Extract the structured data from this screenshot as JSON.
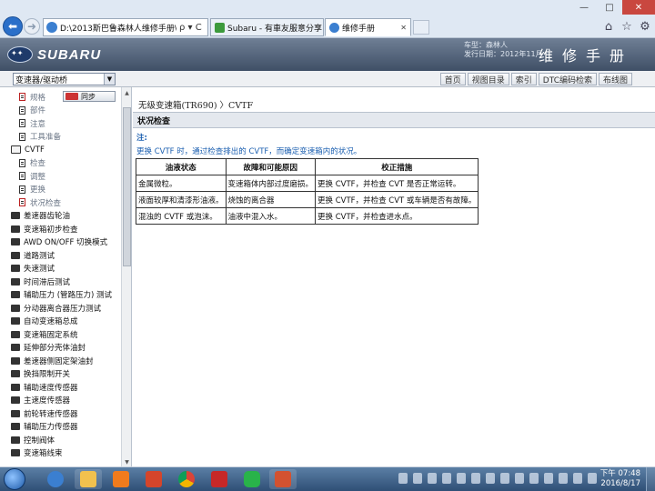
{
  "browser": {
    "address": "D:\\2013斯巴鲁森林人维修手册\\index.h",
    "address_controls": "ρ ▾ C",
    "tabs": [
      {
        "label": "Subaru - 有車友服意分享!頁...",
        "close": "✕"
      },
      {
        "label": "维修手册",
        "close": "✕"
      }
    ],
    "window_controls": [
      "—",
      "□",
      "✕"
    ]
  },
  "header": {
    "brand": "SUBARU",
    "model_line": "车型：森林人",
    "date_line": "发行日期：2012年11月",
    "title": "维修手册"
  },
  "toolbar": {
    "selected_section": "变速器/驱动桥",
    "links": [
      "首页",
      "视图目录",
      "索引",
      "DTC编码检索",
      "布线图"
    ]
  },
  "sidebar": {
    "sync_label": "同步",
    "items": [
      {
        "label": "规格",
        "type": "doc-red",
        "indent": 1
      },
      {
        "label": "部件",
        "type": "doc",
        "indent": 1
      },
      {
        "label": "注意",
        "type": "doc",
        "indent": 1
      },
      {
        "label": "工具准备",
        "type": "doc",
        "indent": 1
      },
      {
        "label": "CVTF",
        "type": "folder-open",
        "indent": 0
      },
      {
        "label": "检查",
        "type": "doc",
        "indent": 1
      },
      {
        "label": "调整",
        "type": "doc",
        "indent": 1
      },
      {
        "label": "更换",
        "type": "doc",
        "indent": 1
      },
      {
        "label": "状况检查",
        "type": "doc-red",
        "indent": 1
      },
      {
        "label": "差速器齿轮油",
        "type": "folder",
        "indent": 0
      },
      {
        "label": "变速箱初步检查",
        "type": "folder",
        "indent": 0
      },
      {
        "label": "AWD ON/OFF 切换模式",
        "type": "folder",
        "indent": 0
      },
      {
        "label": "道路测试",
        "type": "folder",
        "indent": 0
      },
      {
        "label": "失速测试",
        "type": "folder",
        "indent": 0
      },
      {
        "label": "时间滞后测试",
        "type": "folder",
        "indent": 0
      },
      {
        "label": "辅助压力 (管路压力) 测试",
        "type": "folder",
        "indent": 0
      },
      {
        "label": "分动器离合器压力测试",
        "type": "folder",
        "indent": 0
      },
      {
        "label": "自动变速箱总成",
        "type": "folder",
        "indent": 0
      },
      {
        "label": "变速箱固定系统",
        "type": "folder",
        "indent": 0
      },
      {
        "label": "延伸部分壳体油封",
        "type": "folder",
        "indent": 0
      },
      {
        "label": "差速器侧固定架油封",
        "type": "folder",
        "indent": 0
      },
      {
        "label": "换挡限制开关",
        "type": "folder",
        "indent": 0
      },
      {
        "label": "辅助速度传感器",
        "type": "folder",
        "indent": 0
      },
      {
        "label": "主速度传感器",
        "type": "folder",
        "indent": 0
      },
      {
        "label": "前轮转速传感器",
        "type": "folder",
        "indent": 0
      },
      {
        "label": "辅助压力传感器",
        "type": "folder",
        "indent": 0
      },
      {
        "label": "控制阀体",
        "type": "folder",
        "indent": 0
      },
      {
        "label": "变速箱线束",
        "type": "folder",
        "indent": 0
      }
    ]
  },
  "content": {
    "breadcrumb": "无级变速箱(TR690) 〉CVTF",
    "section_title": "状况检查",
    "note_label": "注:",
    "note_text": "更换 CVTF 时，通过检查排出的 CVTF，而确定变速箱内的状况。",
    "table": {
      "headers": [
        "油液状态",
        "故障和可能原因",
        "校正措施"
      ],
      "rows": [
        [
          "金属微粒。",
          "变速箱体内部过度磨损。",
          "更换 CVTF，并检查 CVT 是否正常运转。"
        ],
        [
          "液面较厚和清漆形油液。",
          "烧蚀的离合器",
          "更换 CVTF，并检查 CVT 或车辆是否有故障。"
        ],
        [
          "混浊的 CVTF 或泡沫。",
          "油液中混入水。",
          "更换 CVTF，并检查进水点。"
        ]
      ]
    }
  },
  "taskbar": {
    "time": "下午 07:48",
    "date": "2016/8/17"
  },
  "colors": {
    "note_blue": "#1b5fb0",
    "header_dark": "#3f4f66",
    "taskbar": "#2f4f76"
  }
}
